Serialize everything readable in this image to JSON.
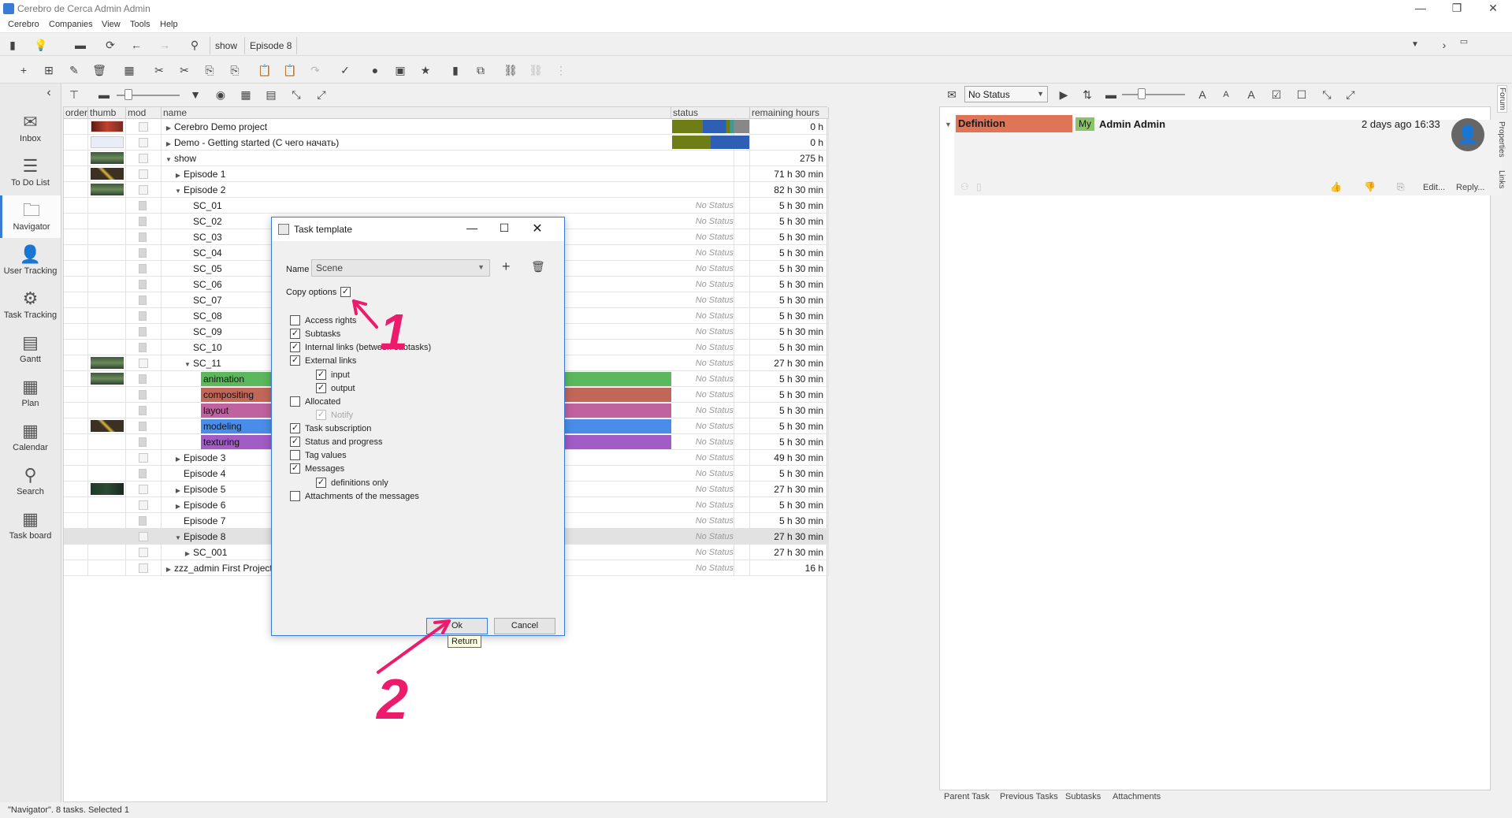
{
  "window": {
    "title": "Cerebro de Cerca  Admin Admin",
    "controls": [
      "—",
      "❐",
      "✕"
    ]
  },
  "menu": [
    "Cerebro",
    "Companies",
    "View",
    "Tools",
    "Help"
  ],
  "breadcrumb": [
    "show",
    "Episode 8"
  ],
  "nav": [
    {
      "label": "Inbox",
      "icon": "envelope-icon",
      "glyph": "✉"
    },
    {
      "label": "To Do List",
      "icon": "list-check-icon",
      "glyph": "☰"
    },
    {
      "label": "Navigator",
      "icon": "folder-icon",
      "glyph": "🗀"
    },
    {
      "label": "User Tracking",
      "icon": "user-tracking-icon",
      "glyph": "👤"
    },
    {
      "label": "Task Tracking",
      "icon": "task-tracking-icon",
      "glyph": "⚙"
    },
    {
      "label": "Gantt",
      "icon": "gantt-icon",
      "glyph": "▤"
    },
    {
      "label": "Plan",
      "icon": "plan-icon",
      "glyph": "▦"
    },
    {
      "label": "Calendar",
      "icon": "calendar-icon",
      "glyph": "▦"
    },
    {
      "label": "Search",
      "icon": "search-icon",
      "glyph": "⚲"
    },
    {
      "label": "Task board",
      "icon": "task-board-icon",
      "glyph": "▦"
    }
  ],
  "grid": {
    "headers": {
      "order": "order",
      "thumb": "thumb",
      "mod": "mod",
      "name": "name",
      "status": "status",
      "remaining": "remaining hours"
    },
    "rows": [
      {
        "indent": 0,
        "arrow": "▶",
        "name": "Cerebro Demo project",
        "status": "",
        "rem": "0 h",
        "thumb": "red",
        "mod": "folder",
        "statusbar": true
      },
      {
        "indent": 0,
        "arrow": "▶",
        "name": "Demo - Getting started (С чего начать)",
        "status": "",
        "rem": "0 h",
        "thumb": "doc",
        "mod": "folder",
        "statusbar2": true
      },
      {
        "indent": 0,
        "arrow": "▼",
        "name": "show",
        "status": "",
        "rem": "275 h",
        "thumb": "green",
        "mod": "folder"
      },
      {
        "indent": 1,
        "arrow": "▶",
        "name": "Episode 1",
        "status": "",
        "rem": "71 h 30 min",
        "thumb": "x",
        "mod": "folder"
      },
      {
        "indent": 1,
        "arrow": "▼",
        "name": "Episode 2",
        "status": "",
        "rem": "82 h 30 min",
        "thumb": "green",
        "mod": "folder"
      },
      {
        "indent": 2,
        "arrow": "",
        "name": "SC_01",
        "status": "No Status",
        "rem": "5 h 30 min",
        "mod": "doc"
      },
      {
        "indent": 2,
        "arrow": "",
        "name": "SC_02",
        "status": "No Status",
        "rem": "5 h 30 min",
        "mod": "doc"
      },
      {
        "indent": 2,
        "arrow": "",
        "name": "SC_03",
        "status": "No Status",
        "rem": "5 h 30 min",
        "mod": "doc"
      },
      {
        "indent": 2,
        "arrow": "",
        "name": "SC_04",
        "status": "No Status",
        "rem": "5 h 30 min",
        "mod": "doc"
      },
      {
        "indent": 2,
        "arrow": "",
        "name": "SC_05",
        "status": "No Status",
        "rem": "5 h 30 min",
        "mod": "doc"
      },
      {
        "indent": 2,
        "arrow": "",
        "name": "SC_06",
        "status": "No Status",
        "rem": "5 h 30 min",
        "mod": "doc"
      },
      {
        "indent": 2,
        "arrow": "",
        "name": "SC_07",
        "status": "No Status",
        "rem": "5 h 30 min",
        "mod": "doc"
      },
      {
        "indent": 2,
        "arrow": "",
        "name": "SC_08",
        "status": "No Status",
        "rem": "5 h 30 min",
        "mod": "doc"
      },
      {
        "indent": 2,
        "arrow": "",
        "name": "SC_09",
        "status": "No Status",
        "rem": "5 h 30 min",
        "mod": "doc"
      },
      {
        "indent": 2,
        "arrow": "",
        "name": "SC_10",
        "status": "No Status",
        "rem": "5 h 30 min",
        "mod": "doc"
      },
      {
        "indent": 2,
        "arrow": "▼",
        "name": "SC_11",
        "status": "No Status",
        "rem": "27 h 30 min",
        "thumb": "green",
        "mod": "folder"
      },
      {
        "indent": 3,
        "arrow": "",
        "name": "animation",
        "status": "No Status",
        "rem": "5 h 30 min",
        "thumb": "green",
        "mod": "doc",
        "bar": "#5cb85c"
      },
      {
        "indent": 3,
        "arrow": "",
        "name": "compositing",
        "status": "No Status",
        "rem": "5 h 30 min",
        "mod": "doc",
        "bar": "#c0675a"
      },
      {
        "indent": 3,
        "arrow": "",
        "name": "layout",
        "status": "No Status",
        "rem": "5 h 30 min",
        "mod": "doc",
        "bar": "#c061a0"
      },
      {
        "indent": 3,
        "arrow": "",
        "name": "modeling",
        "status": "No Status",
        "rem": "5 h 30 min",
        "thumb": "x",
        "mod": "doc",
        "bar": "#4a8de8"
      },
      {
        "indent": 3,
        "arrow": "",
        "name": "texturing",
        "status": "No Status",
        "rem": "5 h 30 min",
        "mod": "doc",
        "bar": "#a25cc6"
      },
      {
        "indent": 1,
        "arrow": "▶",
        "name": "Episode 3",
        "status": "No Status",
        "rem": "49 h 30 min",
        "mod": "folder"
      },
      {
        "indent": 1,
        "arrow": "",
        "name": "Episode 4",
        "status": "No Status",
        "rem": "5 h 30 min",
        "mod": "doc"
      },
      {
        "indent": 1,
        "arrow": "▶",
        "name": "Episode 5",
        "status": "No Status",
        "rem": "27 h 30 min",
        "thumb": "dark",
        "mod": "folder"
      },
      {
        "indent": 1,
        "arrow": "▶",
        "name": "Episode 6",
        "status": "No Status",
        "rem": "5 h 30 min",
        "mod": "folder"
      },
      {
        "indent": 1,
        "arrow": "",
        "name": "Episode 7",
        "status": "No Status",
        "rem": "5 h 30 min",
        "mod": "doc"
      },
      {
        "indent": 1,
        "arrow": "▼",
        "name": "Episode 8",
        "status": "No Status",
        "rem": "27 h 30 min",
        "mod": "folder",
        "selected": true
      },
      {
        "indent": 2,
        "arrow": "▶",
        "name": "SC_001",
        "status": "No Status",
        "rem": "27 h 30 min",
        "mod": "folder"
      },
      {
        "indent": 0,
        "arrow": "▶",
        "name": "zzz_admin First Project",
        "status": "No Status",
        "rem": "16 h",
        "mod": "folder"
      }
    ]
  },
  "dialog": {
    "title": "Task template",
    "name_label": "Name",
    "name_value": "Scene",
    "copy_options_label": "Copy options",
    "copy_options_checked": true,
    "options": [
      {
        "label": "Access rights",
        "checked": false,
        "level": 0,
        "disabled": false
      },
      {
        "label": "Subtasks",
        "checked": true,
        "level": 0,
        "disabled": false
      },
      {
        "label": "Internal links (between subtasks)",
        "checked": true,
        "level": 0,
        "disabled": false
      },
      {
        "label": "External links",
        "checked": true,
        "level": 0,
        "disabled": false
      },
      {
        "label": "input",
        "checked": true,
        "level": 1,
        "disabled": false
      },
      {
        "label": "output",
        "checked": true,
        "level": 1,
        "disabled": false
      },
      {
        "label": "Allocated",
        "checked": false,
        "level": 0,
        "disabled": false
      },
      {
        "label": "Notify",
        "checked": true,
        "level": 1,
        "disabled": true
      },
      {
        "label": "Task subscription",
        "checked": true,
        "level": 0,
        "disabled": false
      },
      {
        "label": "Status and progress",
        "checked": true,
        "level": 0,
        "disabled": false
      },
      {
        "label": "Tag values",
        "checked": false,
        "level": 0,
        "disabled": false
      },
      {
        "label": "Messages",
        "checked": true,
        "level": 0,
        "disabled": false
      },
      {
        "label": "definitions only",
        "checked": true,
        "level": 1,
        "disabled": false
      },
      {
        "label": "Attachments of the messages",
        "checked": false,
        "level": 0,
        "disabled": false
      }
    ],
    "ok_label": "Ok",
    "cancel_label": "Cancel",
    "tooltip": "Return"
  },
  "annotations": {
    "one": "1",
    "two": "2"
  },
  "right_panel": {
    "status_select": "No Status",
    "message_type": "Definition",
    "my_badge": "My",
    "author": "Admin Admin",
    "time": "2 days ago 16:33",
    "edit_label": "Edit...",
    "reply_label": "Reply...",
    "bottom_links": [
      "Parent Task",
      "Previous Tasks",
      "Subtasks",
      "Attachments"
    ],
    "vertical_tabs": [
      "Forum",
      "Properties",
      "Links"
    ]
  },
  "statusbar": "\"Navigator\". 8 tasks. Selected 1",
  "colors": {
    "accent": "#3a7bd5",
    "definition": "#e07456",
    "my_badge": "#8dc26b",
    "pink_annotation": "#ec1b6c"
  }
}
